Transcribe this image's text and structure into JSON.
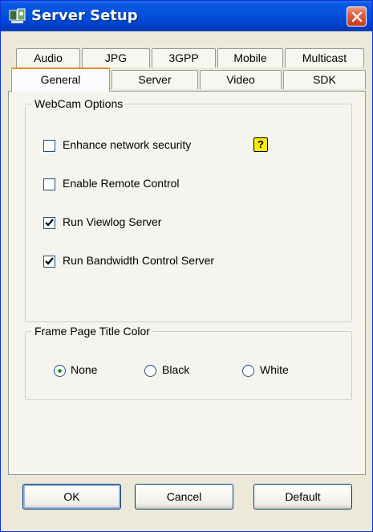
{
  "window": {
    "title": "Server Setup",
    "close_icon": "close-icon",
    "app_icon": "webcam-app-icon"
  },
  "tabs_row_top": [
    {
      "label": "Audio"
    },
    {
      "label": "JPG"
    },
    {
      "label": "3GPP"
    },
    {
      "label": "Mobile"
    },
    {
      "label": "Multicast"
    }
  ],
  "tabs_row_bottom": [
    {
      "label": "General",
      "active": true
    },
    {
      "label": "Server"
    },
    {
      "label": "Video"
    },
    {
      "label": "SDK"
    }
  ],
  "webcam_options": {
    "title": "WebCam Options",
    "items": [
      {
        "label": "Enhance network security",
        "checked": false
      },
      {
        "label": "Enable Remote Control",
        "checked": false
      },
      {
        "label": "Run Viewlog Server",
        "checked": true
      },
      {
        "label": "Run Bandwidth Control Server",
        "checked": true
      }
    ],
    "help_icon": "?"
  },
  "frame_title_color": {
    "title": "Frame Page Title Color",
    "options": [
      {
        "label": "None",
        "selected": true
      },
      {
        "label": "Black",
        "selected": false
      },
      {
        "label": "White",
        "selected": false
      }
    ]
  },
  "buttons": {
    "ok": "OK",
    "cancel": "Cancel",
    "default": "Default"
  },
  "colors": {
    "titlebar": "#0453dd",
    "active_tab_accent": "#e68b2c",
    "check_mark": "#21a121"
  }
}
